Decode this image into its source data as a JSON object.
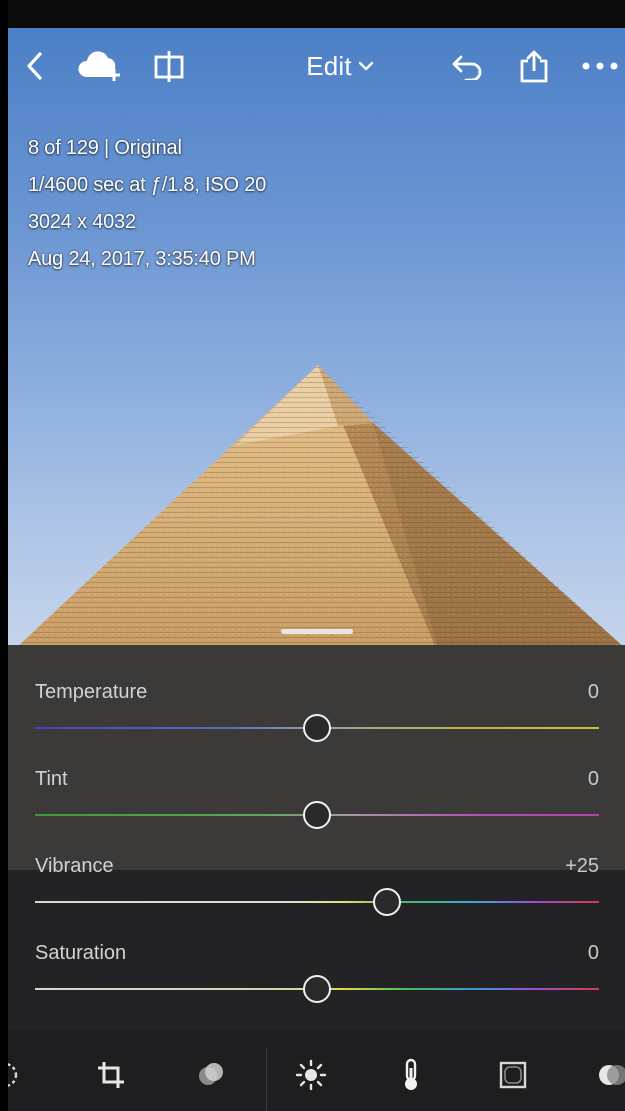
{
  "header": {
    "edit_label": "Edit",
    "icons": [
      "back-icon",
      "cloud-add-icon",
      "compare-icon",
      "chevron-down-icon",
      "undo-icon",
      "share-icon",
      "more-icon"
    ]
  },
  "photo_info": {
    "line1": "8 of 129 | Original",
    "line2": "1/4600 sec at ƒ/1.8, ISO 20",
    "line3": "3024 x 4032",
    "line4": "Aug 24, 2017, 3:35:40 PM"
  },
  "sliders": [
    {
      "label": "Temperature",
      "value": "0",
      "position": 0.5
    },
    {
      "label": "Tint",
      "value": "0",
      "position": 0.5
    },
    {
      "label": "Vibrance",
      "value": "+25",
      "position": 0.625
    },
    {
      "label": "Saturation",
      "value": "0",
      "position": 0.5
    }
  ],
  "toolbar": {
    "icons": [
      "selective-icon",
      "crop-icon",
      "presets-icon",
      "light-icon",
      "color-icon",
      "effects-icon",
      "optics-icon"
    ]
  },
  "colors": {
    "panel_light": "#3b3a39",
    "panel_dark": "#232326",
    "knob_border": "#f0f0f0"
  }
}
